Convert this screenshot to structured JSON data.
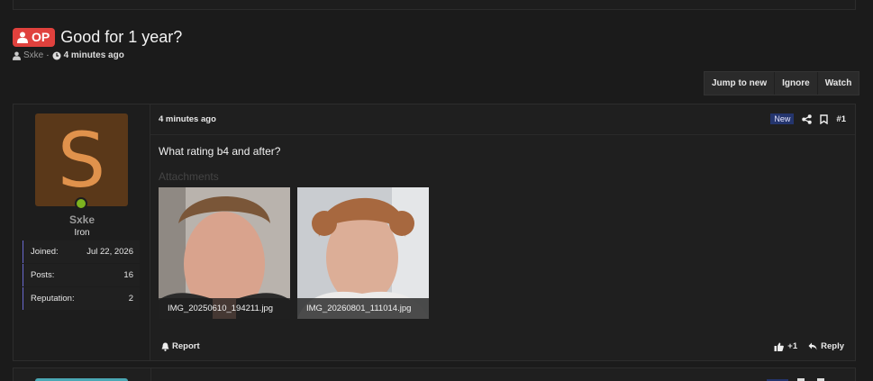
{
  "thread": {
    "op_label": "OP",
    "title": "Good for 1 year?",
    "author": "Sxke",
    "separator": "·",
    "time_ago": "4 minutes ago"
  },
  "actions": {
    "jump_to_new": "Jump to new",
    "ignore": "Ignore",
    "watch": "Watch"
  },
  "user": {
    "avatar_letter": "S",
    "name": "Sxke",
    "rank": "Iron",
    "stats": [
      {
        "label": "Joined:",
        "value": "Jul 22, 2026"
      },
      {
        "label": "Posts:",
        "value": "16"
      },
      {
        "label": "Reputation:",
        "value": "2"
      }
    ]
  },
  "post": {
    "time": "4 minutes ago",
    "new_badge": "New",
    "number": "#1",
    "body": "What rating b4 and after?",
    "attachments_label": "Attachments",
    "attachments": [
      {
        "filename": "IMG_20250610_194211.jpg"
      },
      {
        "filename": "IMG_20260801_111014.jpg"
      }
    ],
    "report_label": "Report",
    "like_count": "+1",
    "reply_label": "Reply"
  },
  "colors": {
    "op_badge": "#e0413d",
    "avatar_bg": "#5a3819",
    "avatar_letter": "#e0924c",
    "online": "#7cb21f",
    "new_badge": "#24356d"
  },
  "icons": [
    "user-icon",
    "clock-icon",
    "share-icon",
    "bookmark-icon",
    "bell-icon",
    "thumbs-up-icon",
    "reply-icon"
  ]
}
